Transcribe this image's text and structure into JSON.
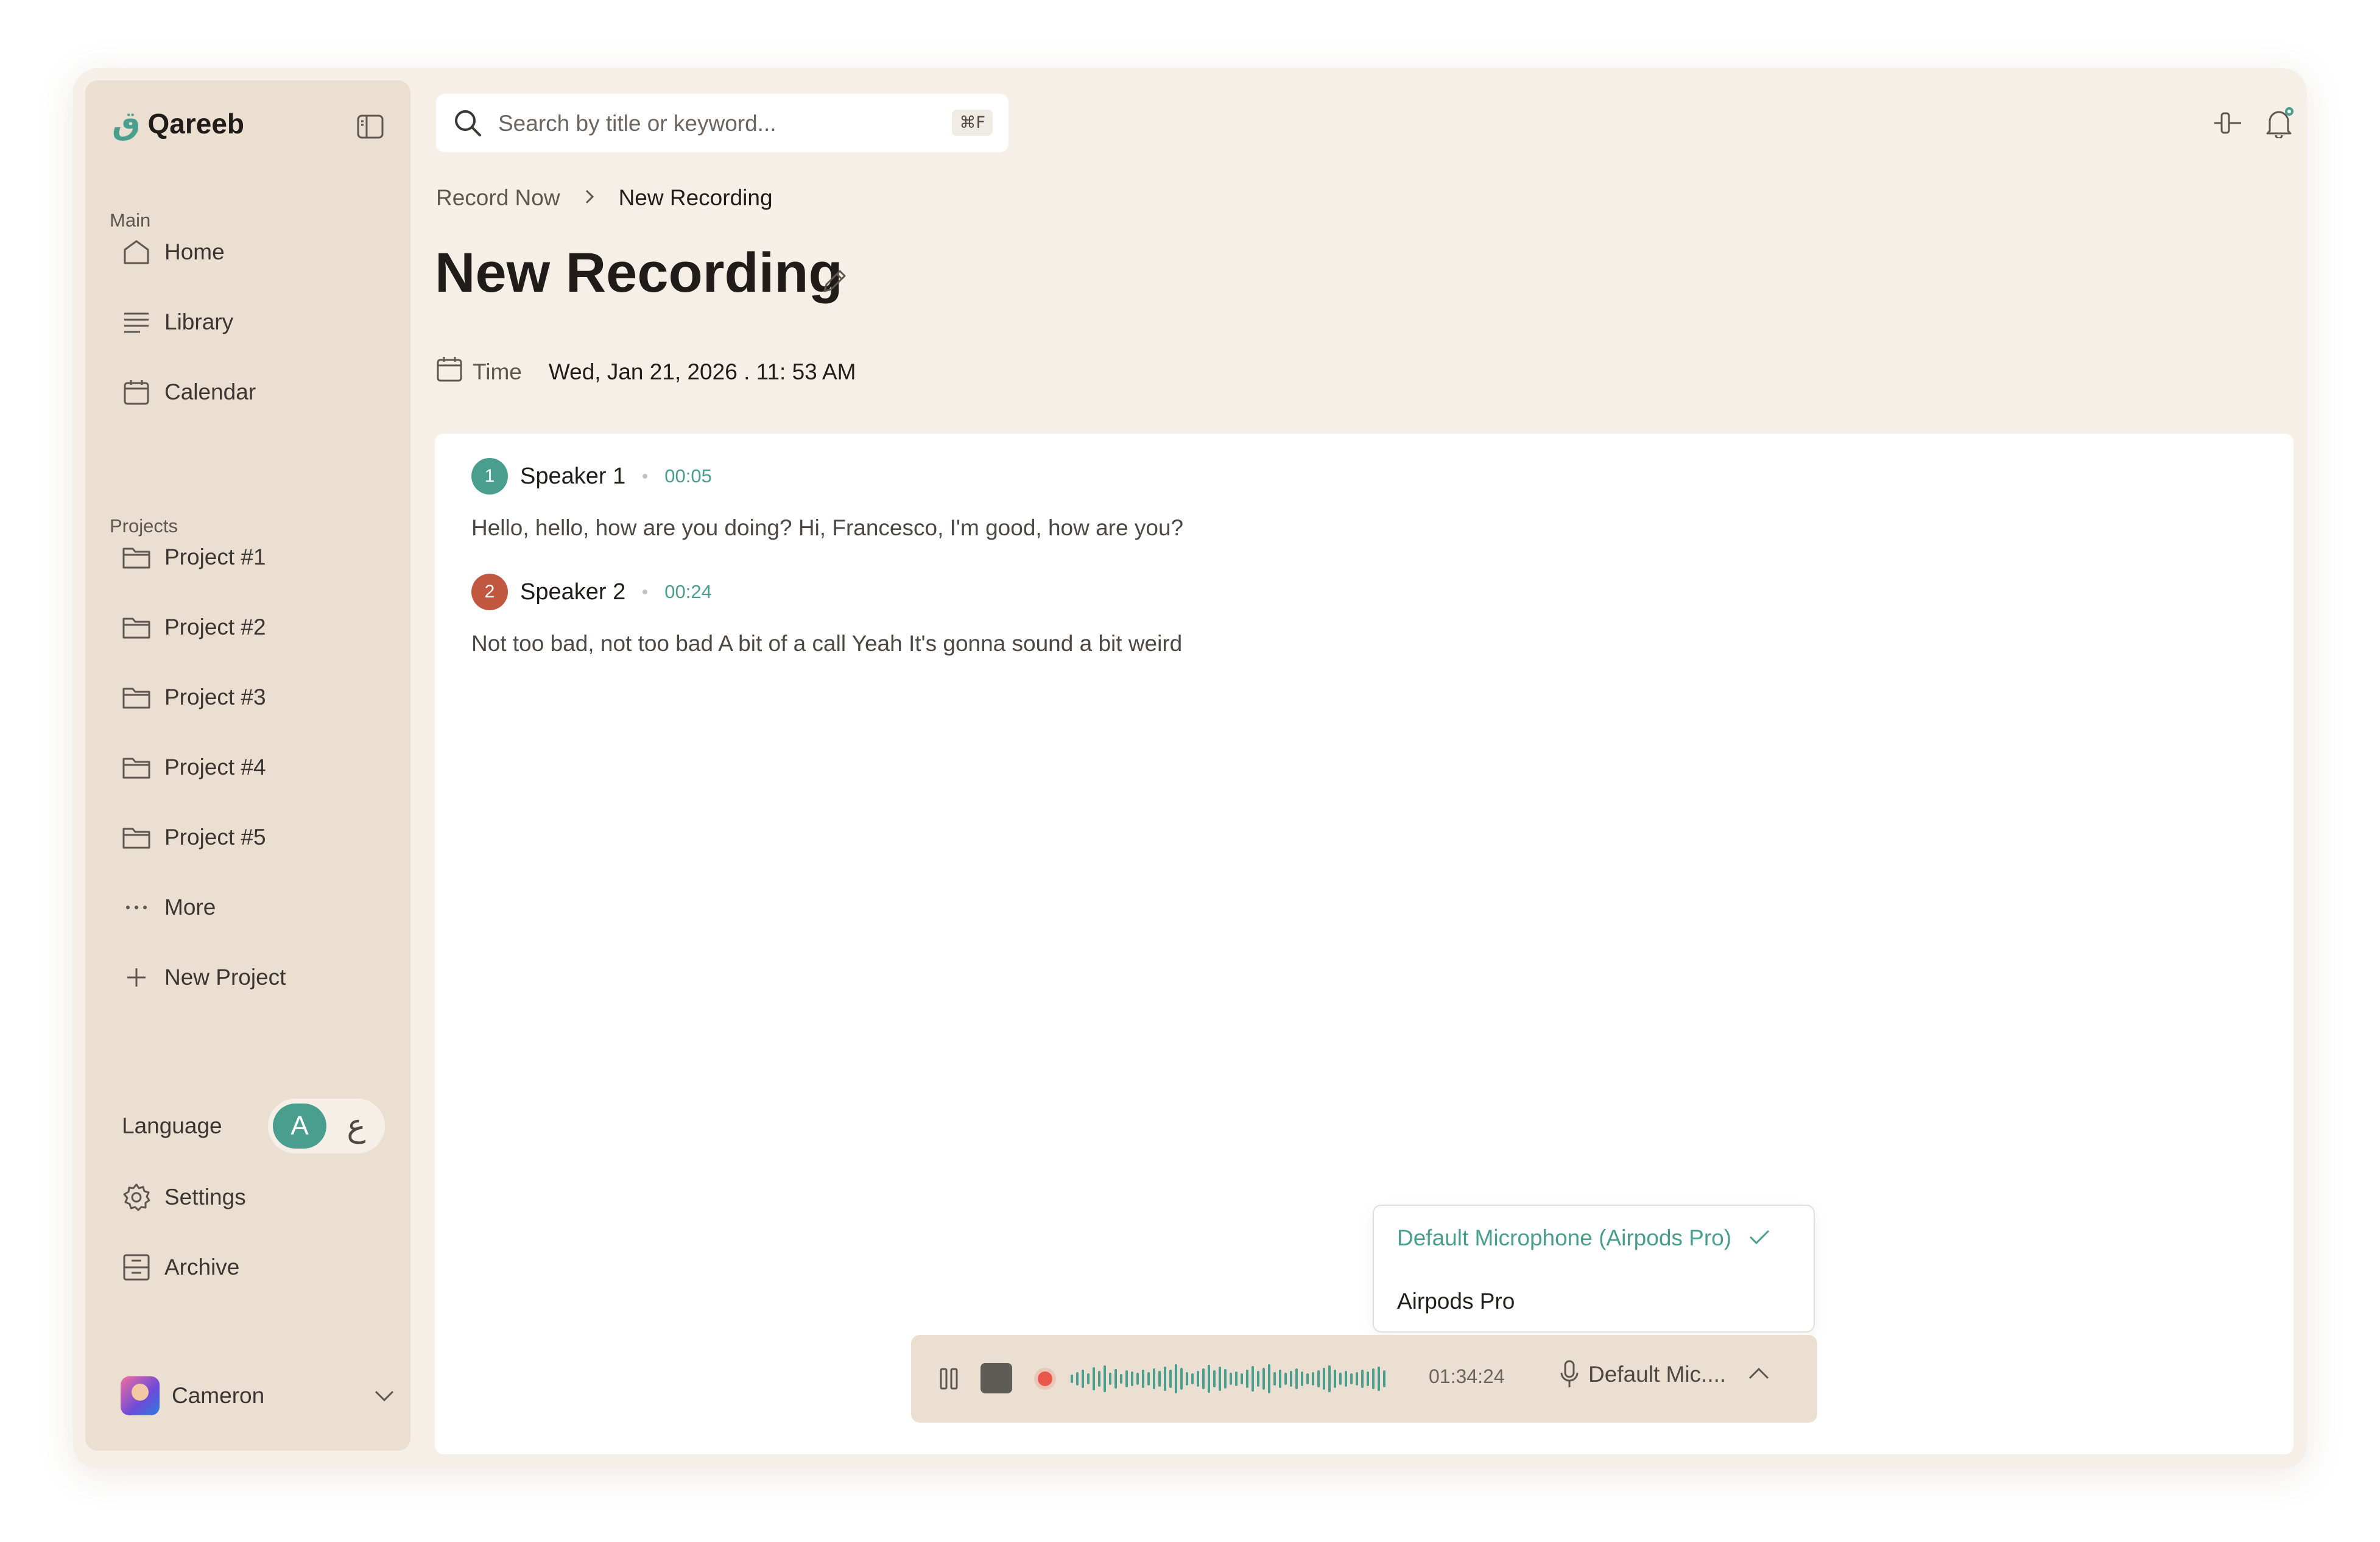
{
  "app": {
    "name": "Qareeb",
    "logo_glyph": "ق",
    "accent_color": "#4a9e8e",
    "record_color": "#e8574a",
    "speaker2_color": "#c2573f"
  },
  "sidebar": {
    "main_label": "Main",
    "main_items": [
      {
        "label": "Home",
        "icon": "home-icon"
      },
      {
        "label": "Library",
        "icon": "library-icon"
      },
      {
        "label": "Calendar",
        "icon": "calendar-icon"
      }
    ],
    "projects_label": "Projects",
    "project_items": [
      {
        "label": "Project #1",
        "icon": "folder-icon"
      },
      {
        "label": "Project #2",
        "icon": "folder-icon"
      },
      {
        "label": "Project #3",
        "icon": "folder-icon"
      },
      {
        "label": "Project #4",
        "icon": "folder-icon"
      },
      {
        "label": "Project #5",
        "icon": "folder-icon"
      }
    ],
    "more_label": "More",
    "new_project_label": "New Project",
    "language_label": "Language",
    "language_options": [
      "A",
      "ع"
    ],
    "settings_label": "Settings",
    "archive_label": "Archive",
    "user_name": "Cameron"
  },
  "search": {
    "placeholder": "Search by title or keyword...",
    "shortcut": "⌘F"
  },
  "breadcrumb": {
    "parent": "Record Now",
    "current": "New Recording"
  },
  "page": {
    "title": "New Recording",
    "time_label": "Time",
    "time_value": "Wed, Jan 21, 2026 . 11: 53 AM"
  },
  "transcript": [
    {
      "number": "1",
      "speaker": "Speaker 1",
      "timestamp": "00:05",
      "text": "Hello, hello, how are you doing? Hi, Francesco, I'm good, how are you?"
    },
    {
      "number": "2",
      "speaker": "Speaker 2",
      "timestamp": "00:24",
      "text": "Not too bad, not too bad A bit of a call Yeah It's gonna sound a bit weird"
    }
  ],
  "mic_menu": {
    "selected": "Default Microphone (Airpods Pro)",
    "other": "Airpods Pro"
  },
  "recorder": {
    "elapsed": "01:34:24",
    "mic_label": "Default Mic...."
  }
}
